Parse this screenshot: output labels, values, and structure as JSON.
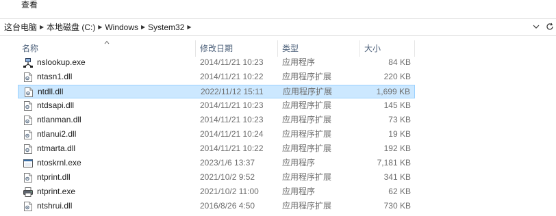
{
  "menu": {
    "view_label": "查看"
  },
  "breadcrumb": [
    {
      "label": "这台电脑"
    },
    {
      "label": "本地磁盘 (C:)"
    },
    {
      "label": "Windows"
    },
    {
      "label": "System32"
    }
  ],
  "columns": {
    "name": "名称",
    "modified": "修改日期",
    "type": "类型",
    "size": "大小"
  },
  "files": [
    {
      "name": "nslookup.exe",
      "modified": "2014/11/21 10:23",
      "type": "应用程序",
      "size": "84 KB",
      "icon": "network-app-icon",
      "selected": false
    },
    {
      "name": "ntasn1.dll",
      "modified": "2014/11/21 10:22",
      "type": "应用程序扩展",
      "size": "220 KB",
      "icon": "dll-file-icon",
      "selected": false
    },
    {
      "name": "ntdll.dll",
      "modified": "2022/11/12 15:11",
      "type": "应用程序扩展",
      "size": "1,699 KB",
      "icon": "dll-file-icon",
      "selected": true
    },
    {
      "name": "ntdsapi.dll",
      "modified": "2014/11/21 10:23",
      "type": "应用程序扩展",
      "size": "145 KB",
      "icon": "dll-file-icon",
      "selected": false
    },
    {
      "name": "ntlanman.dll",
      "modified": "2014/11/21 10:23",
      "type": "应用程序扩展",
      "size": "73 KB",
      "icon": "dll-file-icon",
      "selected": false
    },
    {
      "name": "ntlanui2.dll",
      "modified": "2014/11/21 10:24",
      "type": "应用程序扩展",
      "size": "19 KB",
      "icon": "dll-file-icon",
      "selected": false
    },
    {
      "name": "ntmarta.dll",
      "modified": "2014/11/21 10:22",
      "type": "应用程序扩展",
      "size": "192 KB",
      "icon": "dll-file-icon",
      "selected": false
    },
    {
      "name": "ntoskrnl.exe",
      "modified": "2023/1/6 13:37",
      "type": "应用程序",
      "size": "7,181 KB",
      "icon": "app-window-icon",
      "selected": false
    },
    {
      "name": "ntprint.dll",
      "modified": "2021/10/2 9:52",
      "type": "应用程序扩展",
      "size": "341 KB",
      "icon": "dll-file-icon",
      "selected": false
    },
    {
      "name": "ntprint.exe",
      "modified": "2021/10/2 11:00",
      "type": "应用程序",
      "size": "62 KB",
      "icon": "printer-icon",
      "selected": false
    },
    {
      "name": "ntshrui.dll",
      "modified": "2016/8/26 4:50",
      "type": "应用程序扩展",
      "size": "730 KB",
      "icon": "dll-file-icon",
      "selected": false
    }
  ],
  "colors": {
    "selection_bg": "#cce8ff",
    "selection_border": "#99d1ff",
    "header_text": "#4c607a",
    "muted_text": "#6d6d6d"
  }
}
